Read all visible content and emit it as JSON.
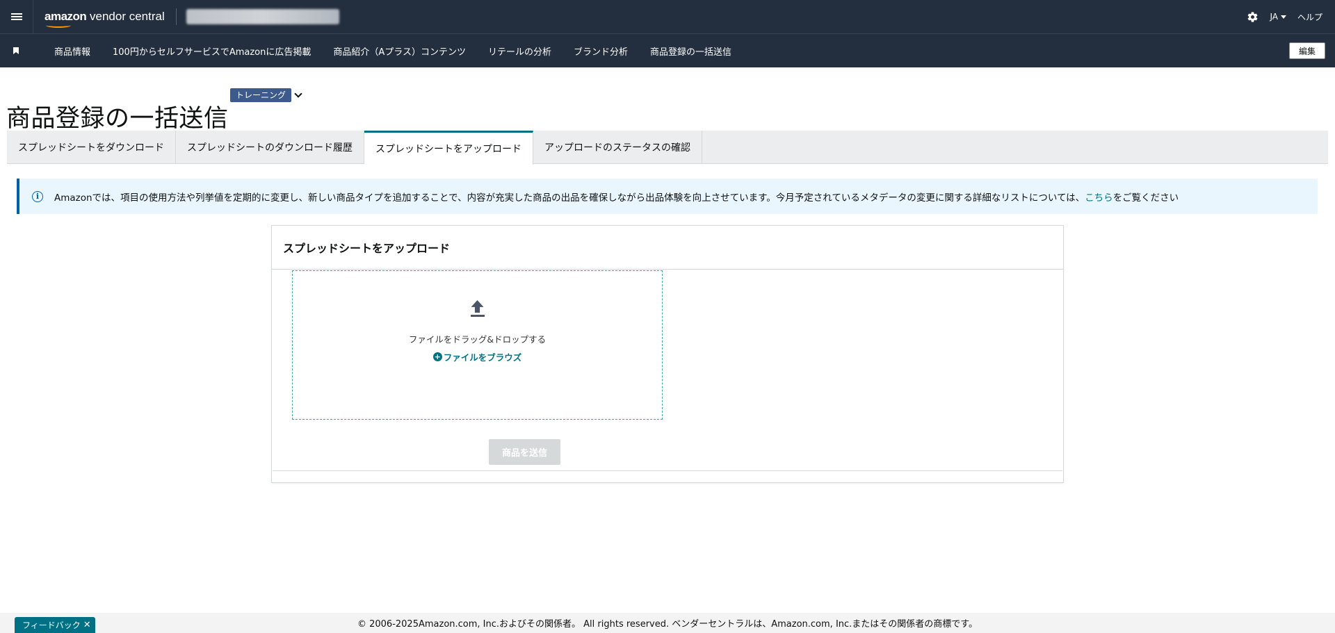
{
  "topbar": {
    "logo_prefix": "amazon",
    "logo_suffix": " vendor central",
    "lang": "JA",
    "help": "ヘルプ"
  },
  "nav": {
    "items": [
      "商品情報",
      "100円からセルフサービスでAmazonに広告掲載",
      "商品紹介（Aプラス）コンテンツ",
      "リテールの分析",
      "ブランド分析",
      "商品登録の一括送信"
    ],
    "edit": "編集"
  },
  "page": {
    "title": "商品登録の一括送信",
    "training": "トレーニング"
  },
  "tabs": [
    "スプレッドシートをダウンロード",
    "スプレッドシートのダウンロード履歴",
    "スプレッドシートをアップロード",
    "アップロードのステータスの確認"
  ],
  "banner": {
    "text": "Amazonでは、項目の使用方法や列挙値を定期的に変更し、新しい商品タイプを追加することで、内容が充実した商品の出品を確保しながら出品体験を向上させています。今月予定されているメタデータの変更に関する詳細なリストについては、",
    "link": "こちら",
    "suffix": "をご覧ください"
  },
  "upload": {
    "header": "スプレッドシートをアップロード",
    "drop_text": "ファイルをドラッグ&ドロップする",
    "browse": "ファイルをブラウズ",
    "submit": "商品を送信"
  },
  "footer": {
    "text": "© 2006-2025Amazon.com, Inc.およびその関係者。 All rights reserved. ベンダーセントラルは、Amazon.com, Inc.またはその関係者の商標です。"
  },
  "feedback": {
    "label": "フィードバック",
    "close": "✕"
  }
}
